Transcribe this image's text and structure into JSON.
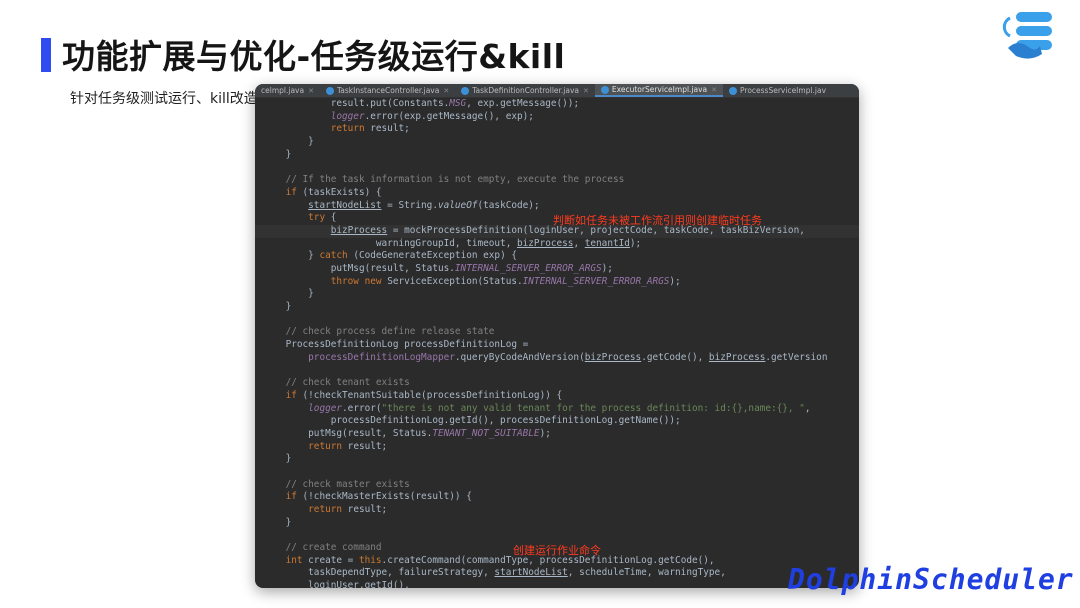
{
  "slide": {
    "title": "功能扩展与优化-任务级运行&kill",
    "subtitle": "针对任务级测试运行、kill改造",
    "brand": "DolphinScheduler"
  },
  "editor": {
    "tabs": [
      {
        "label": "celmpl.java",
        "active": false
      },
      {
        "label": "TaskInstanceController.java",
        "active": false
      },
      {
        "label": "TaskDefinitionController.java",
        "active": false
      },
      {
        "label": "ExecutorServiceImpl.java",
        "active": true
      },
      {
        "label": "ProcessServiceImpl.jav",
        "active": false
      }
    ],
    "annotations": {
      "mock_note": "判断如任务未被工作流引用则创建临时任务",
      "create_note": "创建运行作业命令"
    }
  },
  "colors": {
    "accent": "#2f4cf0",
    "editor_bg": "#2b2b2b",
    "annotation": "#ff3b1f"
  }
}
